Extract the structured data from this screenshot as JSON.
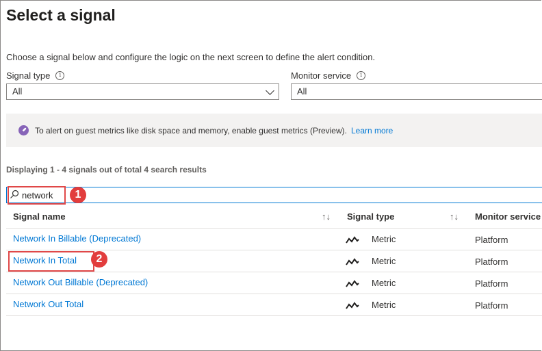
{
  "page": {
    "title": "Select a signal",
    "description": "Choose a signal below and configure the logic on the next screen to define the alert condition."
  },
  "filters": {
    "signal_type_label": "Signal type",
    "signal_type_value": "All",
    "monitor_service_label": "Monitor service",
    "monitor_service_value": "All"
  },
  "banner": {
    "text": "To alert on guest metrics like disk space and memory, enable guest metrics (Preview).",
    "link": "Learn more"
  },
  "results": {
    "summary": "Displaying 1 - 4 signals out of total 4 search results"
  },
  "search": {
    "value": "network"
  },
  "callouts": [
    "1",
    "2"
  ],
  "table": {
    "headers": {
      "signal_name": "Signal name",
      "signal_type": "Signal type",
      "monitor_service": "Monitor service"
    },
    "rows": [
      {
        "name": "Network In Billable (Deprecated)",
        "type": "Metric",
        "service": "Platform"
      },
      {
        "name": "Network In Total",
        "type": "Metric",
        "service": "Platform"
      },
      {
        "name": "Network Out Billable (Deprecated)",
        "type": "Metric",
        "service": "Platform"
      },
      {
        "name": "Network Out Total",
        "type": "Metric",
        "service": "Platform"
      }
    ]
  },
  "colors": {
    "link": "#0078d4",
    "accent": "#0078d4",
    "callout": "#e23d3d",
    "banner_icon": "#8764b8"
  }
}
